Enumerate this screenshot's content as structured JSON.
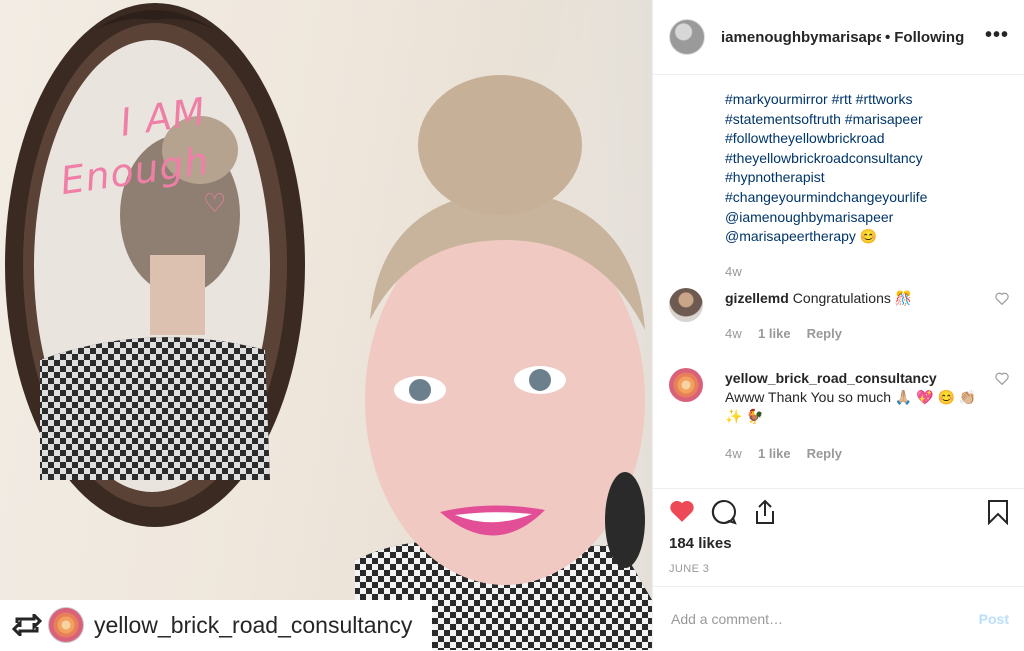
{
  "photo": {
    "mirror_line1": "I AM",
    "mirror_line2": "Enough",
    "repost_username": "yellow_brick_road_consultancy"
  },
  "header": {
    "username": "iamenoughbymarisapeer",
    "separator": "•",
    "follow_status": "Following",
    "more": "•••"
  },
  "caption": {
    "lines": [
      "#markyourmirror #rtt #rttworks",
      "#statementsoftruth #marisapeer",
      "#followtheyellowbrickroad",
      "#theyellowbrickroadconsultancy",
      "#hypnotherapist",
      "#changeyourmindchangeyourlife",
      "@iamenoughbymarisapeer",
      "@marisapeertherapy 😊"
    ],
    "time": "4w"
  },
  "comments": [
    {
      "username": "gizellemd",
      "text": "Congratulations 🎊",
      "time": "4w",
      "likes": "1 like",
      "reply": "Reply"
    },
    {
      "username": "yellow_brick_road_consultancy",
      "text": "Awww Thank You so much 🙏🏼 💖 😊 👏🏼 ✨ 🐓",
      "time": "4w",
      "likes": "1 like",
      "reply": "Reply"
    }
  ],
  "actions": {
    "likes": "184 likes",
    "date": "JUNE 3",
    "liked": true,
    "like_color": "#ed4956"
  },
  "add_comment": {
    "placeholder": "Add a comment…",
    "post_label": "Post"
  }
}
